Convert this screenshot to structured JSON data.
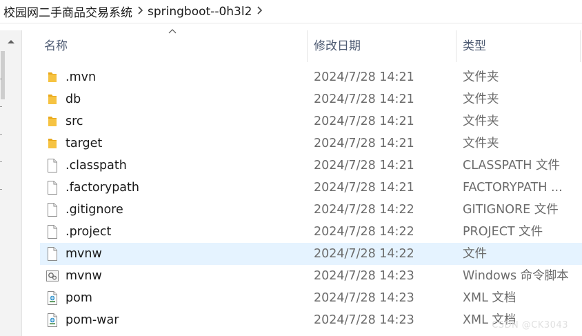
{
  "breadcrumb": {
    "items": [
      "校园网二手商品交易系统",
      "springboot--0h3l2"
    ],
    "separator": "›"
  },
  "columns": {
    "name": "名称",
    "date": "修改日期",
    "type": "类型"
  },
  "files": [
    {
      "name": ".mvn",
      "date": "2024/7/28 14:21",
      "type": "文件夹",
      "icon": "folder-icon"
    },
    {
      "name": "db",
      "date": "2024/7/28 14:21",
      "type": "文件夹",
      "icon": "folder-icon"
    },
    {
      "name": "src",
      "date": "2024/7/28 14:21",
      "type": "文件夹",
      "icon": "folder-icon"
    },
    {
      "name": "target",
      "date": "2024/7/28 14:21",
      "type": "文件夹",
      "icon": "folder-icon"
    },
    {
      "name": ".classpath",
      "date": "2024/7/28 14:21",
      "type": "CLASSPATH 文件",
      "icon": "file-icon"
    },
    {
      "name": ".factorypath",
      "date": "2024/7/28 14:21",
      "type": "FACTORYPATH ...",
      "icon": "file-icon"
    },
    {
      "name": ".gitignore",
      "date": "2024/7/28 14:22",
      "type": "GITIGNORE 文件",
      "icon": "file-icon"
    },
    {
      "name": ".project",
      "date": "2024/7/28 14:22",
      "type": "PROJECT 文件",
      "icon": "file-icon"
    },
    {
      "name": "mvnw",
      "date": "2024/7/28 14:22",
      "type": "文件",
      "icon": "file-icon",
      "selected": true
    },
    {
      "name": "mvnw",
      "date": "2024/7/28 14:23",
      "type": "Windows 命令脚本",
      "icon": "script-icon"
    },
    {
      "name": "pom",
      "date": "2024/7/28 14:23",
      "type": "XML 文档",
      "icon": "xml-icon"
    },
    {
      "name": "pom-war",
      "date": "2024/7/28 14:23",
      "type": "XML 文档",
      "icon": "xml-icon"
    }
  ],
  "watermark": "CSDN @CK3043",
  "colors": {
    "selected_row": "#e5f3ff",
    "folder": "#f6c342",
    "header_text": "#4d5a72",
    "secondary_text": "#6b6b6b"
  }
}
